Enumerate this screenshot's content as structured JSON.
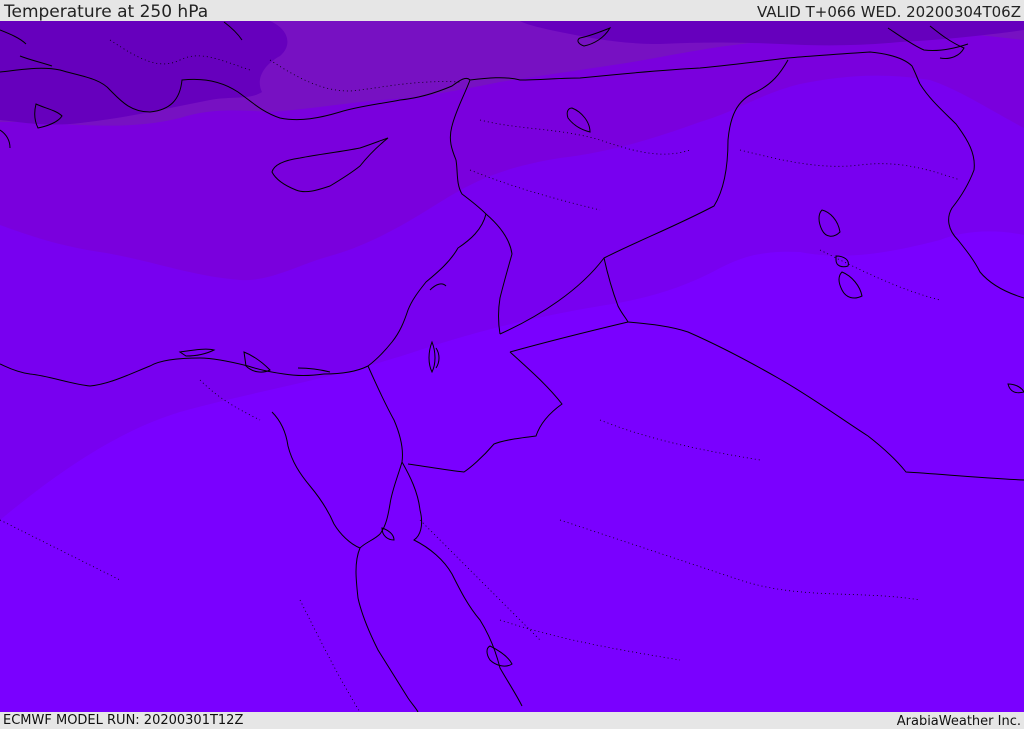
{
  "header": {
    "title": "Temperature at 250 hPa",
    "valid": "VALID T+066 WED. 20200304T06Z"
  },
  "footer": {
    "model_run": "ECMWF MODEL RUN: 20200301T12Z",
    "credit": "ArabiaWeather Inc."
  },
  "colors": {
    "band_coldest": "#6600bd",
    "band_cold": "#7711c2",
    "band_mid": "#7a00dd",
    "band_warm": "#7800f0",
    "band_warmest": "#7a00ff",
    "coastline": "#000000",
    "header_bg": "#e6e6e6"
  }
}
